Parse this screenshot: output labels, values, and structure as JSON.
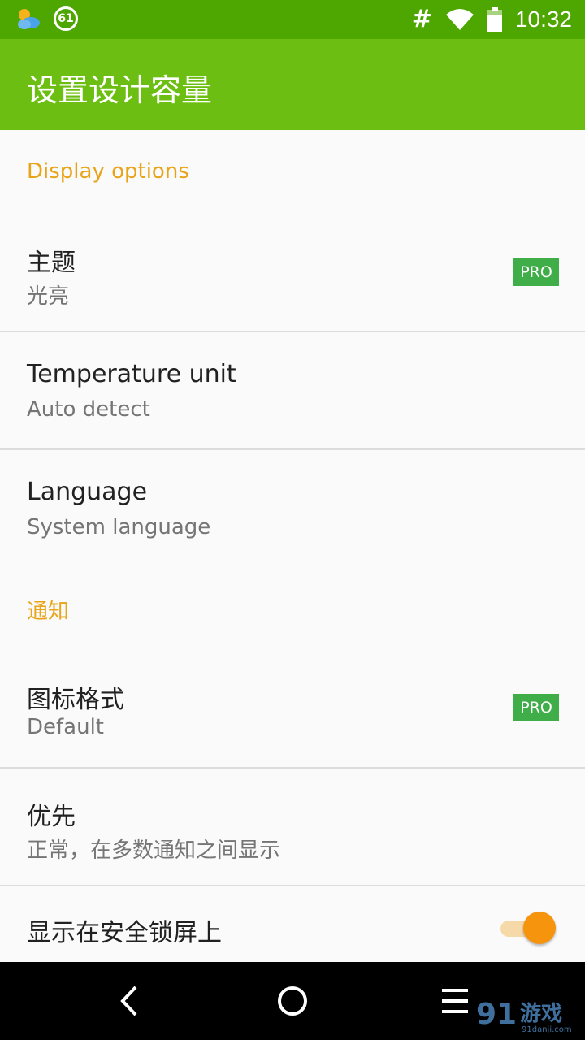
{
  "status_bar": {
    "left_icons": [
      "weather-icon",
      "notification-count-icon"
    ],
    "notification_count": "61",
    "signal_text": "#",
    "time": "10:32"
  },
  "app_bar": {
    "title": "设置设计容量"
  },
  "sections": [
    {
      "header": "Display options",
      "items": [
        {
          "title": "主题",
          "subtitle": "光亮",
          "badge": "PRO"
        },
        {
          "title": "Temperature unit",
          "subtitle": "Auto detect"
        },
        {
          "title": "Language",
          "subtitle": "System language"
        }
      ]
    },
    {
      "header": "通知",
      "items": [
        {
          "title": "图标格式",
          "subtitle": "Default",
          "badge": "PRO"
        },
        {
          "title": "优先",
          "subtitle": "正常，在多数通知之间显示"
        },
        {
          "title": "显示在安全锁屏上",
          "toggle": true
        }
      ]
    }
  ],
  "nav_bar": {
    "buttons": [
      "back-icon",
      "home-icon",
      "menu-icon"
    ]
  },
  "watermark": {
    "text": "游戏",
    "subtext": "91danji.com"
  },
  "colors": {
    "status_bar": "#4ea600",
    "app_bar": "#6cbf12",
    "section_header": "#e8a316",
    "pro_badge": "#3fae49",
    "toggle_thumb": "#f7940e"
  }
}
